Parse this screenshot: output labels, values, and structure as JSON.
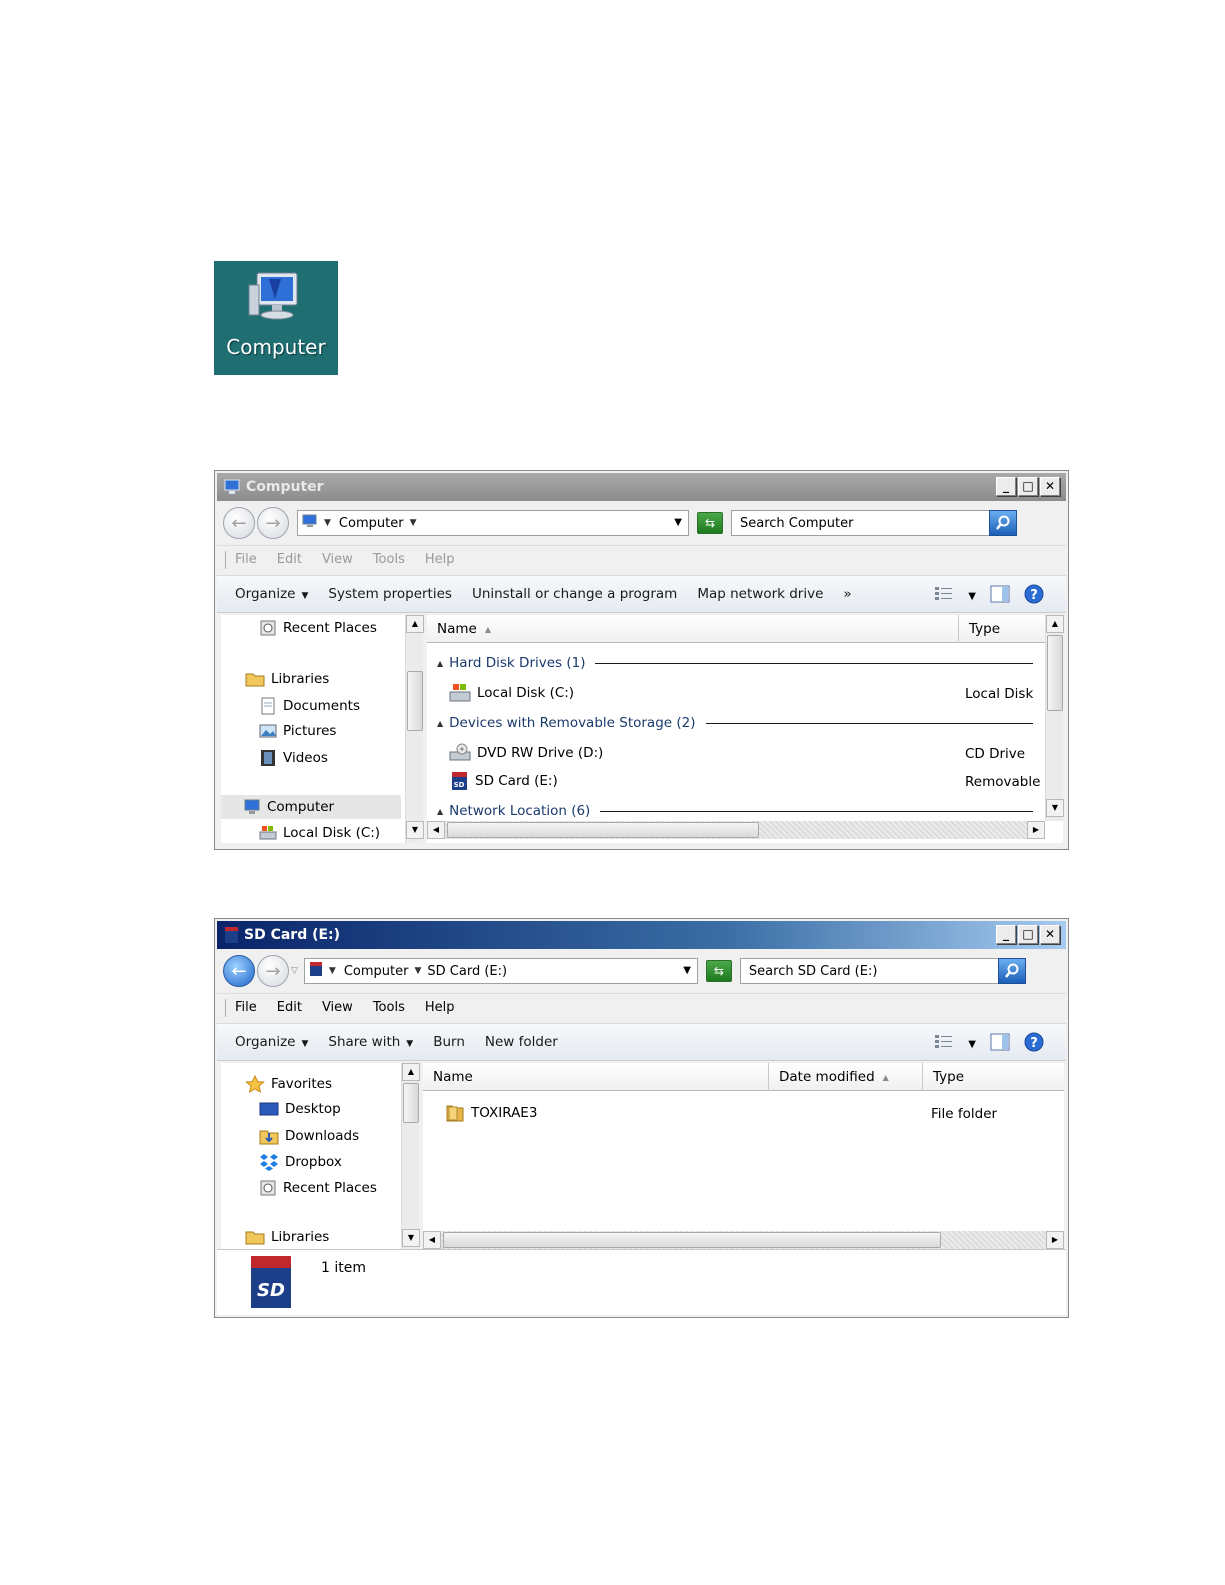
{
  "desktop_icon": {
    "label": "Computer"
  },
  "window1": {
    "title": "Computer",
    "address": {
      "crumbs": [
        "Computer"
      ]
    },
    "search_placeholder": "Search Computer",
    "menu": [
      "File",
      "Edit",
      "View",
      "Tools",
      "Help"
    ],
    "commands": [
      "Organize",
      "System properties",
      "Uninstall or change a program",
      "Map network drive",
      "»"
    ],
    "nav": [
      "Recent Places",
      "Libraries",
      "Documents",
      "Pictures",
      "Videos",
      "Computer",
      "Local Disk (C:)"
    ],
    "columns": [
      "Name",
      "Type"
    ],
    "groups": [
      "Hard Disk Drives (1)",
      "Devices with Removable Storage (2)",
      "Network Location (6)"
    ],
    "rows": [
      {
        "name": "Local Disk (C:)",
        "type": "Local Disk"
      },
      {
        "name": "DVD RW Drive (D:)",
        "type": "CD Drive"
      },
      {
        "name": "SD Card (E:)",
        "type": "Removable D"
      }
    ]
  },
  "window2": {
    "title": "SD Card (E:)",
    "address": {
      "crumbs": [
        "Computer",
        "SD Card (E:)"
      ]
    },
    "search_placeholder": "Search SD Card (E:)",
    "menu": [
      "File",
      "Edit",
      "View",
      "Tools",
      "Help"
    ],
    "commands": [
      "Organize",
      "Share with",
      "Burn",
      "New folder"
    ],
    "nav": [
      "Favorites",
      "Desktop",
      "Downloads",
      "Dropbox",
      "Recent Places",
      "Libraries"
    ],
    "columns": [
      "Name",
      "Date modified",
      "Type"
    ],
    "rows": [
      {
        "name": "TOXIRAE3",
        "type": "File folder"
      }
    ],
    "status": "1 item"
  },
  "colors": {
    "desktop_teal": "#1e6e72",
    "active_title": "#0a246a"
  }
}
